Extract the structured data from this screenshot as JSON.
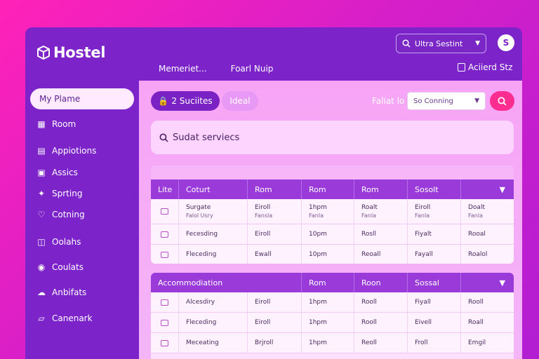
{
  "app": {
    "name": "Hostel"
  },
  "header": {
    "tabs": [
      {
        "label": "Memeriet..."
      },
      {
        "label": "Foarl Nuip"
      }
    ],
    "top_select": {
      "value": "Ultra Sestint"
    },
    "avatar_text": "S",
    "admin_link": "Aciierd Stz"
  },
  "sidebar": {
    "items": [
      {
        "label": "My Plame",
        "icon": "home-icon"
      },
      {
        "label": "Room",
        "icon": "grid-icon"
      },
      {
        "label": "Appiotions",
        "icon": "document-icon"
      },
      {
        "label": "Assics",
        "icon": "calendar-icon"
      },
      {
        "label": "Sprting",
        "icon": "spark-icon"
      },
      {
        "label": "Cotning",
        "icon": "heart-icon"
      },
      {
        "label": "Oolahs",
        "icon": "layout-icon"
      },
      {
        "label": "Coulats",
        "icon": "people-icon"
      },
      {
        "label": "Anbifats",
        "icon": "cloud-icon"
      },
      {
        "label": "Canenark",
        "icon": "bookmark-icon"
      }
    ]
  },
  "filters": {
    "chip_active": "2 Suciites",
    "chip_secondary": "Ideal",
    "filter_label": "Faliat lo",
    "sort_value": "So Conning",
    "search_placeholder": "Sudat serviecs"
  },
  "table1": {
    "headers": [
      "Lite",
      "Coturt",
      "Rom",
      "Rom",
      "Rom",
      "Sosolt",
      ""
    ],
    "rows": [
      {
        "name": "Surgate",
        "name_sub": "Falol Usry",
        "c2": "Eiroll",
        "c2_sub": "Fansla",
        "c3": "1hpm",
        "c3_sub": "Fanla",
        "c4": "Roalt",
        "c4_sub": "Fanla",
        "c5": "Eiroll",
        "c5_sub": "Fanla",
        "c6": "Doalt",
        "c6_sub": "Fanla"
      },
      {
        "name": "Fecesding",
        "c2": "Eiroll",
        "c3": "10pm",
        "c4": "Rosll",
        "c5": "Fiyalt",
        "c6": "Rooal"
      },
      {
        "name": "Fleceding",
        "c2": "Ewall",
        "c3": "10pm",
        "c4": "Reoall",
        "c5": "Fayall",
        "c6": "Roalol"
      }
    ]
  },
  "table2": {
    "headers": [
      "Accommodiation",
      "Rom",
      "Roon",
      "Sossal",
      ""
    ],
    "rows": [
      {
        "name": "Alcesdiry",
        "c2": "Eiroll",
        "c3": "1hpm",
        "c4": "Rooll",
        "c5": "Fiyall",
        "c6": "Rooll"
      },
      {
        "name": "Fleceding",
        "c2": "Eiroll",
        "c3": "1hpm",
        "c4": "Rooll",
        "c5": "Eivell",
        "c6": "Roall"
      },
      {
        "name": "Meceating",
        "c2": "Brjroll",
        "c3": "1hpm",
        "c4": "Reoll",
        "c5": "Froll",
        "c6": "Emgil"
      }
    ]
  }
}
